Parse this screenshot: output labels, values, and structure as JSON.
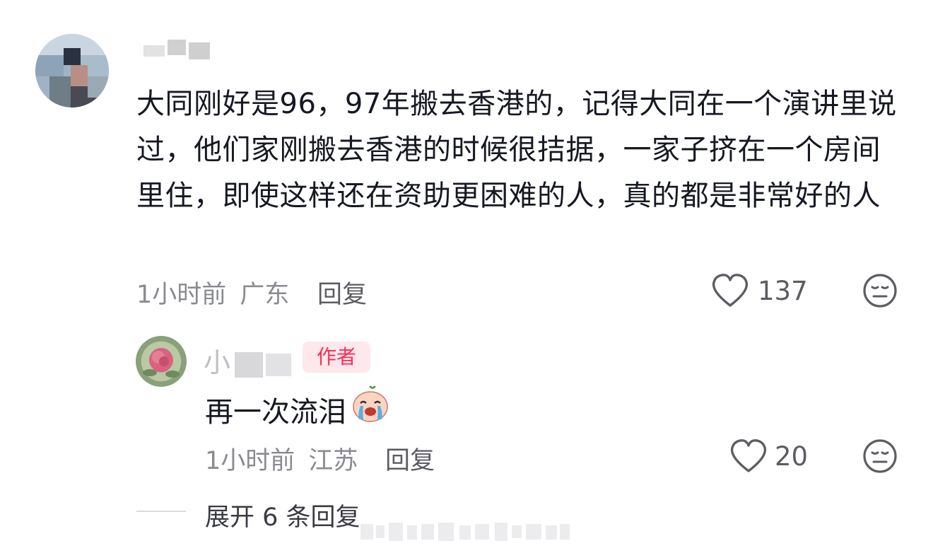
{
  "comment": {
    "text": "大同刚好是96，97年搬去香港的，记得大同在一个演讲里说过，他们家刚搬去香港的时候很拮据，一家子挤在一个房间里住，即使这样还在资助更困难的人，真的都是非常好的人",
    "time": "1小时前",
    "location": "广东",
    "reply_label": "回复",
    "likes": "137"
  },
  "reply": {
    "username": "小",
    "author_badge": "作者",
    "text": "再一次流泪",
    "time": "1小时前",
    "location": "江苏",
    "reply_label": "回复",
    "likes": "20"
  },
  "expand_label": "展开 6 条回复",
  "colors": {
    "text": "#161823",
    "meta": "#8a8b91",
    "badge_bg": "#fde8ec",
    "badge_text": "#fe2c55"
  }
}
